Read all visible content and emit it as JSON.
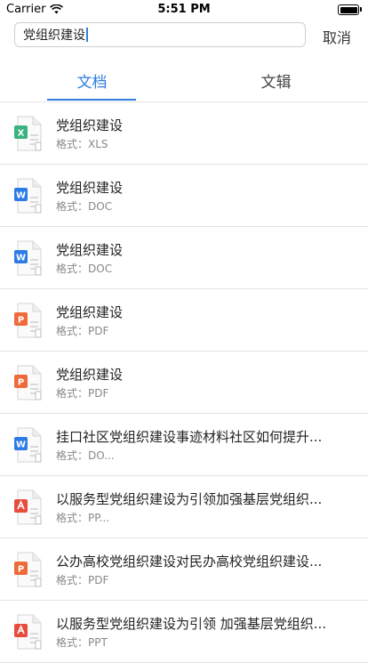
{
  "status_bar": {
    "carrier": "Carrier",
    "time": "5:51 PM"
  },
  "search": {
    "value": "党组织建设",
    "cancel_label": "取消"
  },
  "tabs": [
    {
      "label": "文档",
      "active": true
    },
    {
      "label": "文辑",
      "active": false
    }
  ],
  "colors": {
    "accent": "#2f7de1",
    "xls": "#3ab37e",
    "doc": "#2d7be5",
    "ppt": "#ee6a3a",
    "pdf": "#e84c3d"
  },
  "results": [
    {
      "title": "党组织建设",
      "format_label": "格式：",
      "format": "XLS",
      "icon": "xls-file-icon"
    },
    {
      "title": "党组织建设",
      "format_label": "格式：",
      "format": "DOC",
      "icon": "doc-file-icon"
    },
    {
      "title": "党组织建设",
      "format_label": "格式：",
      "format": "DOC",
      "icon": "doc-file-icon"
    },
    {
      "title": "党组织建设",
      "format_label": "格式：",
      "format": "PDF",
      "icon": "ppt-file-icon"
    },
    {
      "title": "党组织建设",
      "format_label": "格式：",
      "format": "PDF",
      "icon": "ppt-file-icon"
    },
    {
      "title": "挂口社区党组织建设事迹材料社区如何提升...",
      "format_label": "格式：",
      "format": "DO...",
      "icon": "doc-file-icon"
    },
    {
      "title": "以服务型党组织建设为引领加强基层党组织...",
      "format_label": "格式：",
      "format": "PP...",
      "icon": "pdf-file-icon"
    },
    {
      "title": "公办高校党组织建设对民办高校党组织建设...",
      "format_label": "格式：",
      "format": "PDF",
      "icon": "ppt-file-icon"
    },
    {
      "title": "以服务型党组织建设为引领 加强基层党组织...",
      "format_label": "格式：",
      "format": "PPT",
      "icon": "pdf-file-icon"
    }
  ]
}
